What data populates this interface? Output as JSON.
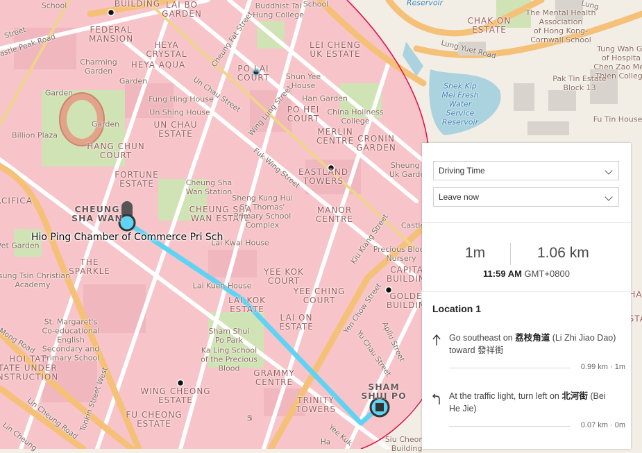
{
  "map": {
    "labels": [
      {
        "text": "School",
        "kind": "plain"
      },
      {
        "text": "BUILDING",
        "kind": "est"
      },
      {
        "text": "LAI BO\nGARDEN",
        "kind": "est"
      },
      {
        "text": "Buddhist Tai\nHung College",
        "kind": "plain"
      },
      {
        "text": "School",
        "kind": "plain"
      },
      {
        "text": "Reservoir",
        "kind": "water"
      },
      {
        "text": "CHAK ON\nESTATE",
        "kind": "est"
      },
      {
        "text": "The Mental Health\nAssociation\nof Hong Kong-\nCornwall School",
        "kind": "plain"
      },
      {
        "text": "Lung Yuet Road",
        "kind": "street"
      },
      {
        "text": "Lung",
        "kind": "street"
      },
      {
        "text": "Tung Wah Gr\nof Hospita\nChen Zao Men\nThien College",
        "kind": "plain"
      },
      {
        "text": "Pak Tin Estate\nBlock 13",
        "kind": "plain"
      },
      {
        "text": "Fu Tin House",
        "kind": "plain"
      },
      {
        "text": "Shek Kip\nMei Fresh\nWater\nService\nReservoir",
        "kind": "water"
      },
      {
        "text": "FEDERAL\nMANSION",
        "kind": "est"
      },
      {
        "text": "Street",
        "kind": "street"
      },
      {
        "text": "astle Peak Road",
        "kind": "street"
      },
      {
        "text": "HEYA\nCRYSTAL",
        "kind": "est"
      },
      {
        "text": "HEYA AQUA",
        "kind": "est"
      },
      {
        "text": "Charming\nGarden",
        "kind": "plain"
      },
      {
        "text": "Garden",
        "kind": "plain"
      },
      {
        "text": "Garden",
        "kind": "plain"
      },
      {
        "text": "Cheung Fat Street",
        "kind": "street"
      },
      {
        "text": "PO LAI\nCOURT",
        "kind": "est"
      },
      {
        "text": "LEI CHENG\nUK ESTATE",
        "kind": "est"
      },
      {
        "text": "Shun Yee\nHouse",
        "kind": "plain"
      },
      {
        "text": "Han Garden",
        "kind": "plain"
      },
      {
        "text": "Un Chau Street",
        "kind": "street"
      },
      {
        "text": "Fung Hing House",
        "kind": "plain"
      },
      {
        "text": "Un Shing House",
        "kind": "plain"
      },
      {
        "text": "UN CHAU\nESTATE",
        "kind": "est"
      },
      {
        "text": "Wing Lung Street",
        "kind": "street"
      },
      {
        "text": "PO HEI\nCOURT",
        "kind": "est"
      },
      {
        "text": "China Holiness\nCollege",
        "kind": "plain"
      },
      {
        "text": "Garden",
        "kind": "plain"
      },
      {
        "text": "Billion Plaza",
        "kind": "plain"
      },
      {
        "text": "MERLIN\nCENTRE",
        "kind": "est"
      },
      {
        "text": "CRONIN\nGARDEN",
        "kind": "est"
      },
      {
        "text": "HANG CHUN\nCOURT",
        "kind": "est"
      },
      {
        "text": "Fuk Wing Street",
        "kind": "street"
      },
      {
        "text": "FORTUNE\nESTATE",
        "kind": "est"
      },
      {
        "text": "EASTLAND\nTOWERS",
        "kind": "est"
      },
      {
        "text": "Sheung Li\nUk Garden",
        "kind": "plain"
      },
      {
        "text": "Cheung Sha\nWan Station",
        "kind": "plain"
      },
      {
        "text": "ACIFICA",
        "kind": "est"
      },
      {
        "text": "CHEUNG\nSHA WAN",
        "kind": "big"
      },
      {
        "text": "CHEUNG SHA\nWAN ESTATE",
        "kind": "est"
      },
      {
        "text": "Sheng Kung Hui\nSt. Thomas'\nPrimary School\nComplex",
        "kind": "plain"
      },
      {
        "text": "MANOR\nCENTRE",
        "kind": "est"
      },
      {
        "text": "Kiu Kiang Street",
        "kind": "street"
      },
      {
        "text": "Castle",
        "kind": "plain"
      },
      {
        "text": "Pet Garden",
        "kind": "plain"
      },
      {
        "text": "Lai Kwai House",
        "kind": "plain"
      },
      {
        "text": "Precious Blood\nNursery",
        "kind": "plain"
      },
      {
        "text": "THE\nSPARKLE",
        "kind": "est"
      },
      {
        "text": "CAPITAL\nBUILDING",
        "kind": "est"
      },
      {
        "text": "Tsung Tsin Christian\nAcademy",
        "kind": "plain"
      },
      {
        "text": "YEE KOK\nCOURT",
        "kind": "est"
      },
      {
        "text": "Lai Kuen House",
        "kind": "plain"
      },
      {
        "text": "YEE CHING\nCOURT",
        "kind": "est"
      },
      {
        "text": "LAI KOK\nESTATE",
        "kind": "est"
      },
      {
        "text": "GOLDEN\nBUILDING",
        "kind": "est"
      },
      {
        "text": "Yen Chow Street",
        "kind": "street"
      },
      {
        "text": "St. Margaret's\nCo-educational\nEnglish\nSecondary and\nPrimary School",
        "kind": "plain"
      },
      {
        "text": "LAI ON\nESTATE",
        "kind": "est"
      },
      {
        "text": "Sham Shui\nPo Park",
        "kind": "plain"
      },
      {
        "text": "Mong Road",
        "kind": "street"
      },
      {
        "text": "Apliu Street",
        "kind": "street"
      },
      {
        "text": "Ka Ling School\nof the Precious\nBlood",
        "kind": "plain"
      },
      {
        "text": "Yu Chau Street",
        "kind": "street"
      },
      {
        "text": "HOI TAT\nTATE UNDER\nNSTRUCTION",
        "kind": "est"
      },
      {
        "text": "GRAMMY\nCENTRE",
        "kind": "est"
      },
      {
        "text": "SHAM\nSHUI PO",
        "kind": "big"
      },
      {
        "text": "WING CHEONG\nESTATE",
        "kind": "est"
      },
      {
        "text": "Tonkin Street West",
        "kind": "street"
      },
      {
        "text": "TRINITY\nTOWERS",
        "kind": "est"
      },
      {
        "text": "FU CHEONG\nESTATE",
        "kind": "est"
      },
      {
        "text": "Lin Cheung Road",
        "kind": "street"
      },
      {
        "text": "Lin Cheung",
        "kind": "street"
      },
      {
        "text": "Yee Kuk",
        "kind": "street"
      },
      {
        "text": "Siu Cheong\nBuilding",
        "kind": "plain"
      },
      {
        "text": "HA",
        "kind": "est"
      },
      {
        "text": "ESTA",
        "kind": "est"
      },
      {
        "text": "Ha",
        "kind": "street"
      },
      {
        "text": "5",
        "kind": "street"
      }
    ],
    "route_origin_label": "Hio Ping Chamber of Commerce Pri Sch",
    "colors": {
      "route": "#5fd3f3",
      "buffer_ring": "#e0144c",
      "buffer_fill": "#f7b6bf"
    }
  },
  "directions": {
    "mode": "Driving Time",
    "departure": "Leave now",
    "summary": {
      "time": "1m",
      "distance": "1.06 km",
      "eta_time": "11:59 AM",
      "eta_zone": "GMT+0800"
    },
    "location_title": "Location 1",
    "steps": [
      {
        "icon": "arrow-up-icon",
        "prefix": "Go southeast on ",
        "bold": "荔枝角道",
        "suffix": " (Li Zhi Jiao Dao) toward 發祥街",
        "meta": "0.99 km · 1m"
      },
      {
        "icon": "turn-left-icon",
        "prefix": "At the traffic light, turn left on ",
        "bold": "北河街",
        "suffix": " (Bei He Jie)",
        "meta": "0.07 km · 0m"
      }
    ]
  }
}
